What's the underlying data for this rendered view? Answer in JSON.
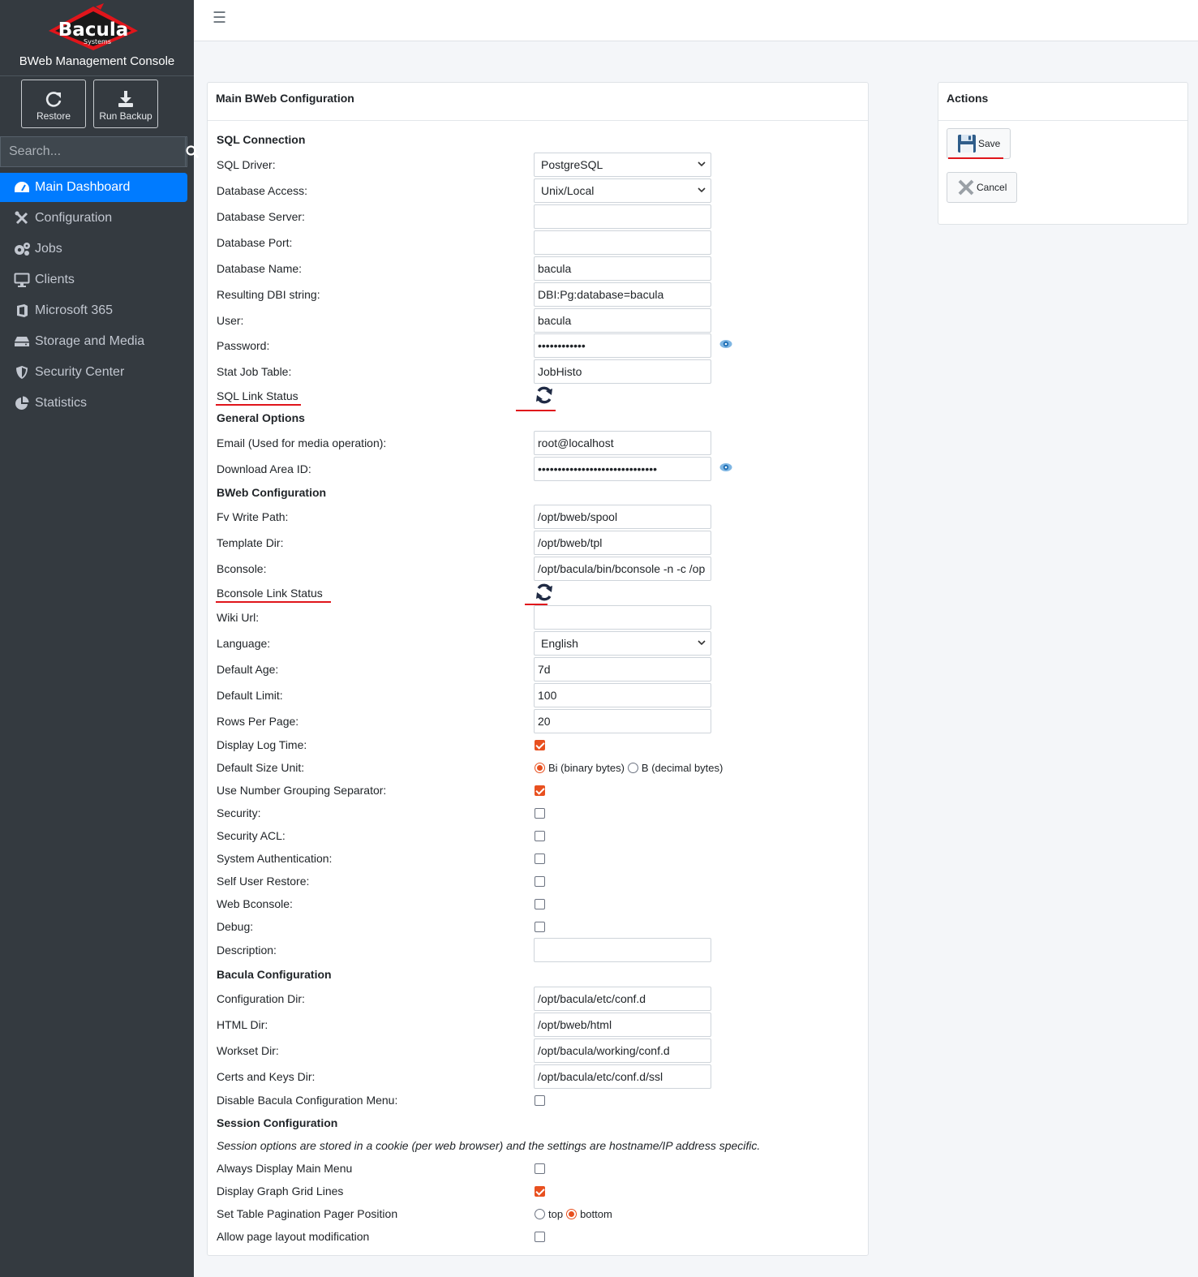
{
  "brand": {
    "logo_text": "Bacula",
    "logo_sub": "Systems",
    "title": "BWeb Management Console"
  },
  "quick_actions": {
    "restore": "Restore",
    "run_backup": "Run Backup"
  },
  "search": {
    "placeholder": "Search..."
  },
  "nav": [
    {
      "label": "Main Dashboard",
      "icon": "dashboard-icon",
      "active": true
    },
    {
      "label": "Configuration",
      "icon": "tools-icon"
    },
    {
      "label": "Jobs",
      "icon": "gears-icon"
    },
    {
      "label": "Clients",
      "icon": "desktop-icon"
    },
    {
      "label": "Microsoft 365",
      "icon": "office-icon"
    },
    {
      "label": "Storage and Media",
      "icon": "hdd-icon"
    },
    {
      "label": "Security Center",
      "icon": "shield-icon"
    },
    {
      "label": "Statistics",
      "icon": "pie-chart-icon"
    }
  ],
  "main": {
    "title": "Main BWeb Configuration",
    "sql": {
      "heading": "SQL Connection",
      "driver_label": "SQL Driver:",
      "driver_value": "PostgreSQL",
      "access_label": "Database Access:",
      "access_value": "Unix/Local",
      "server_label": "Database Server:",
      "server_value": "",
      "port_label": "Database Port:",
      "port_value": "",
      "name_label": "Database Name:",
      "name_value": "bacula",
      "dbi_label": "Resulting DBI string:",
      "dbi_value": "DBI:Pg:database=bacula",
      "user_label": "User:",
      "user_value": "bacula",
      "password_label": "Password:",
      "password_value": "••••••••••••",
      "stat_label": "Stat Job Table:",
      "stat_value": "JobHisto",
      "link_status_label": "SQL Link Status"
    },
    "general": {
      "heading": "General Options",
      "email_label": "Email (Used for media operation):",
      "email_value": "root@localhost",
      "download_label": "Download Area ID:",
      "download_value": "••••••••••••••••••••••••••••••"
    },
    "bweb": {
      "heading": "BWeb Configuration",
      "fv_label": "Fv Write Path:",
      "fv_value": "/opt/bweb/spool",
      "tpl_label": "Template Dir:",
      "tpl_value": "/opt/bweb/tpl",
      "bconsole_label": "Bconsole:",
      "bconsole_value": "/opt/bacula/bin/bconsole -n -c /op",
      "bconsole_link_label": "Bconsole Link Status",
      "wiki_label": "Wiki Url:",
      "wiki_value": "",
      "lang_label": "Language:",
      "lang_value": "English",
      "age_label": "Default Age:",
      "age_value": "7d",
      "limit_label": "Default Limit:",
      "limit_value": "100",
      "rows_label": "Rows Per Page:",
      "rows_value": "20",
      "logtime_label": "Display Log Time:",
      "sizeunit_label": "Default Size Unit:",
      "size_opt1": "Bi (binary bytes)",
      "size_opt2": "B (decimal bytes)",
      "grouping_label": "Use Number Grouping Separator:",
      "security_label": "Security:",
      "security_acl_label": "Security ACL:",
      "sysauth_label": "System Authentication:",
      "selfrestore_label": "Self User Restore:",
      "webbconsole_label": "Web Bconsole:",
      "debug_label": "Debug:",
      "desc_label": "Description:",
      "desc_value": ""
    },
    "bacula": {
      "heading": "Bacula Configuration",
      "confdir_label": "Configuration Dir:",
      "confdir_value": "/opt/bacula/etc/conf.d",
      "htmldir_label": "HTML Dir:",
      "htmldir_value": "/opt/bweb/html",
      "workset_label": "Workset Dir:",
      "workset_value": "/opt/bacula/working/conf.d",
      "certs_label": "Certs and Keys Dir:",
      "certs_value": "/opt/bacula/etc/conf.d/ssl",
      "disable_menu_label": "Disable Bacula Configuration Menu:"
    },
    "session": {
      "heading": "Session Configuration",
      "note": "Session options are stored in a cookie (per web browser) and the settings are hostname/IP address specific.",
      "always_menu_label": "Always Display Main Menu",
      "grid_label": "Display Graph Grid Lines",
      "pager_label": "Set Table Pagination Pager Position",
      "pager_opt1": "top",
      "pager_opt2": "bottom",
      "layout_label": "Allow page layout modification"
    }
  },
  "actions": {
    "title": "Actions",
    "save": "Save",
    "cancel": "Cancel"
  },
  "colors": {
    "sidebar_bg": "#343a40",
    "active_nav": "#007bff",
    "checkbox_accent": "#e8501f",
    "annotation_red": "#e0151b"
  }
}
